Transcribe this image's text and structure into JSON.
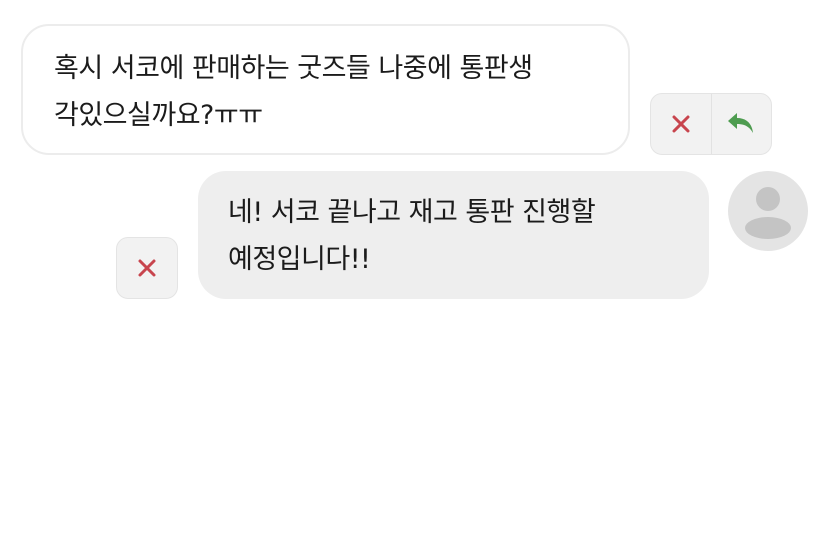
{
  "messages": {
    "incoming": {
      "text": "혹시 서코에 판매하는 굿즈들 나중에 통판생\n각있으실까요?ㅠㅠ"
    },
    "outgoing": {
      "text": "네! 서코 끝나고 재고 통판 진행할\n예정입니다!!"
    }
  },
  "icons": {
    "delete": "close-icon",
    "reply": "reply-arrow-icon",
    "avatar": "default-user-avatar"
  },
  "colors": {
    "delete_icon": "#c8454e",
    "reply_icon": "#4e9c50",
    "outgoing_bubble": "#eeeeee",
    "button_background": "#f2f2f2",
    "avatar_background": "#e4e4e4",
    "avatar_silhouette": "#c4c4c4"
  }
}
